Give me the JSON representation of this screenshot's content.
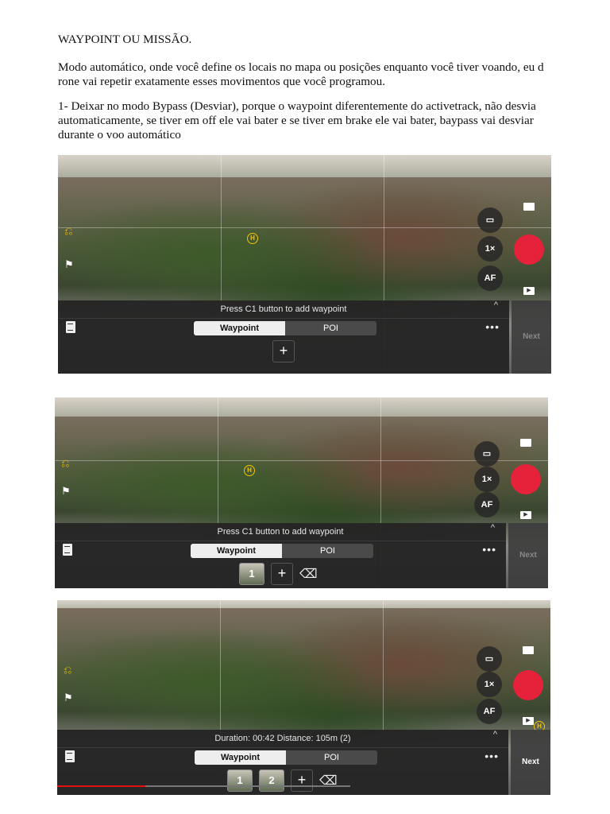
{
  "document": {
    "title": "WAYPOINT OU MISSÃO.",
    "paragraph1": "Modo automático, onde você define os locais no mapa ou posições enquanto você tiver voando, eu d rone vai repetir exatamente esses movimentos que você programou.",
    "paragraph2": "1- Deixar no modo Bypass (Desviar), porque o waypoint diferentemente do activetrack, não desvia automaticamente, se tiver em off ele vai bater e se tiver em brake ele vai bater, baypass vai desviar durante o voo automático"
  },
  "screenshots": [
    {
      "bar_title": "Press C1 button to add waypoint",
      "tab_waypoint": "Waypoint",
      "tab_poi": "POI",
      "next": "Next",
      "zoom": "1×",
      "af": "AF",
      "home": "H"
    },
    {
      "bar_title": "Press C1 button to add waypoint",
      "tab_waypoint": "Waypoint",
      "tab_poi": "POI",
      "next": "Next",
      "zoom": "1×",
      "af": "AF",
      "home": "H",
      "waypoints": [
        "1"
      ]
    },
    {
      "bar_title": "Duration: 00:42 Distance: 105m (2)",
      "tab_waypoint": "Waypoint",
      "tab_poi": "POI",
      "next": "Next",
      "zoom": "1×",
      "af": "AF",
      "home": "H",
      "waypoints": [
        "1",
        "2"
      ]
    }
  ],
  "colors": {
    "record": "#e5223a",
    "bar": "#242424"
  },
  "icons": {
    "plus": "+",
    "delete": "⌫",
    "more": "•••",
    "caret": "^"
  }
}
